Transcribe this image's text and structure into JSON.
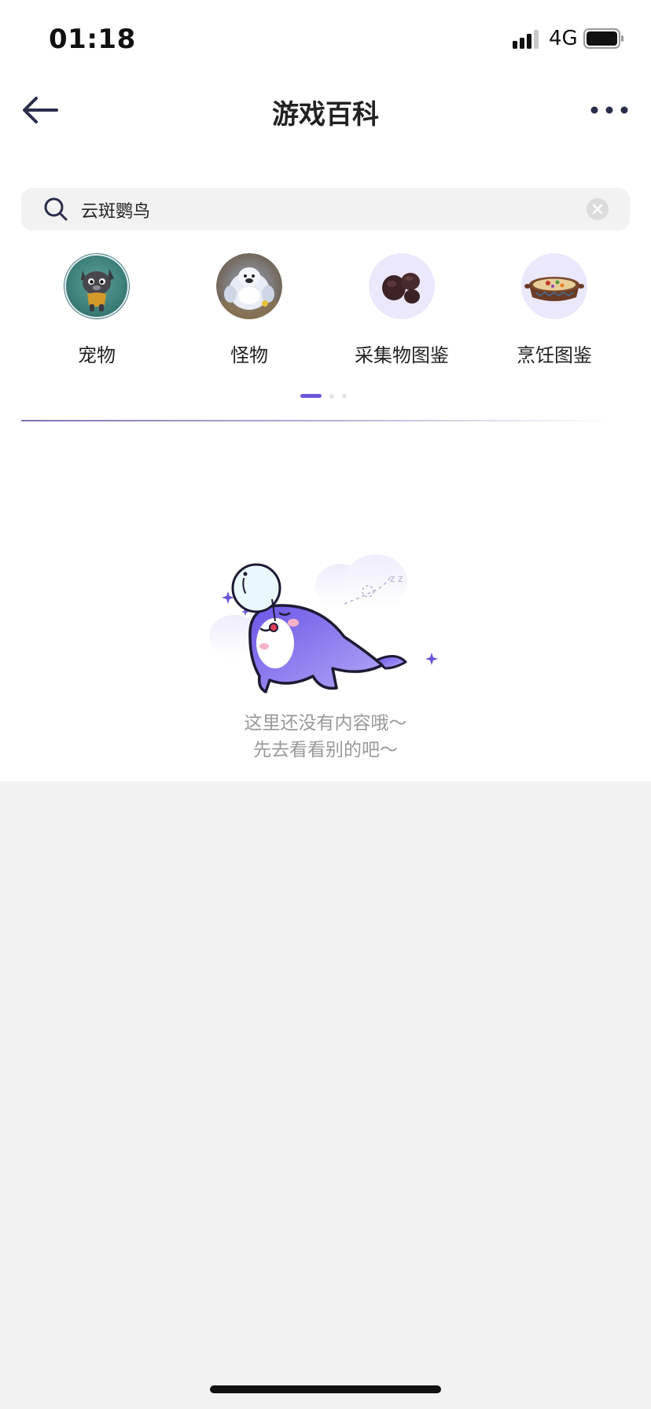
{
  "status_bar": {
    "time": "01:18",
    "network": "4G",
    "signal_icon": "signal-bars-icon",
    "battery_icon": "battery-icon"
  },
  "nav": {
    "title": "游戏百科",
    "back_icon": "arrow-left-icon",
    "more_icon": "more-dots-icon"
  },
  "search": {
    "value": "云斑鹦鸟",
    "placeholder": "",
    "search_icon": "search-icon",
    "clear_icon": "clear-icon"
  },
  "categories": [
    {
      "label": "宠物",
      "icon": "pet-icon"
    },
    {
      "label": "怪物",
      "icon": "monster-icon"
    },
    {
      "label": "采集物图鉴",
      "icon": "gatherable-icon"
    },
    {
      "label": "烹饪图鉴",
      "icon": "cooking-icon"
    }
  ],
  "pager": {
    "total_pages": 3,
    "active_page": 1
  },
  "empty_state": {
    "line1": "这里还没有内容哦～",
    "line2": "先去看看别的吧～"
  },
  "colors": {
    "accent": "#6b56d9",
    "text_primary": "#222222",
    "text_muted": "#999999",
    "background": "#f2f2f2"
  }
}
